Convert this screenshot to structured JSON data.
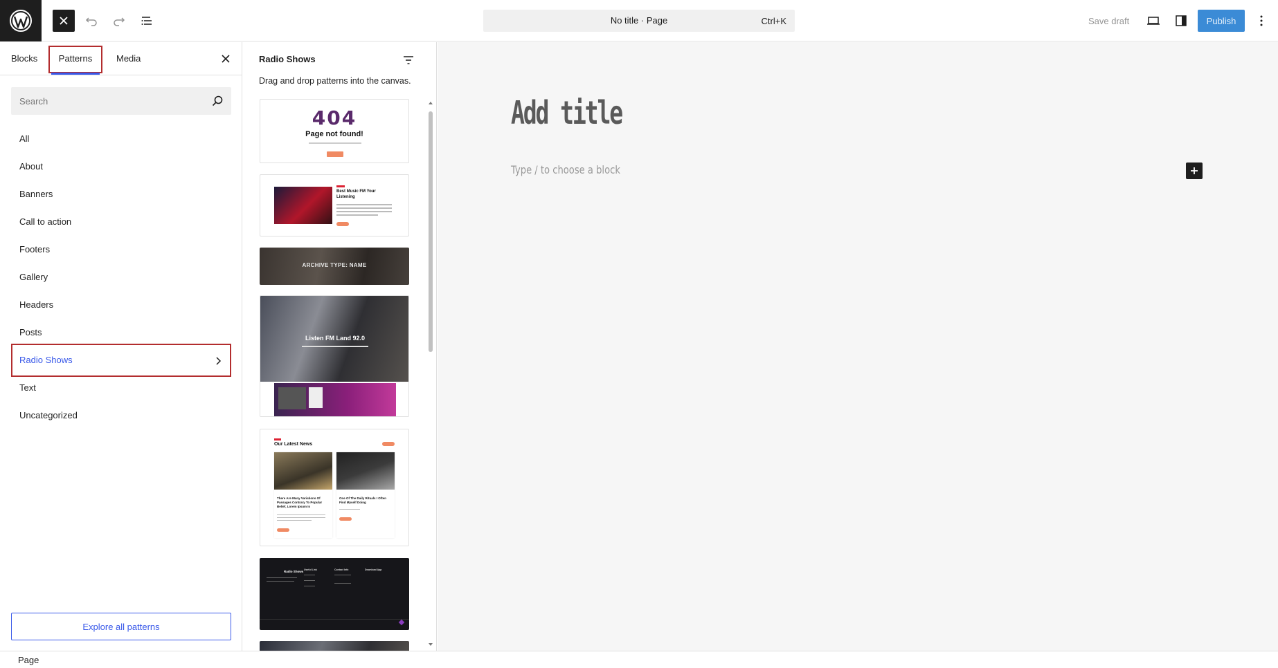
{
  "topbar": {
    "document_title": "No title · Page",
    "shortcut": "Ctrl+K",
    "save_draft_label": "Save draft",
    "publish_label": "Publish",
    "icons": [
      "wordpress-logo",
      "close-icon",
      "undo-icon",
      "redo-icon",
      "document-overview-icon",
      "view-icon",
      "settings-icon",
      "options-icon"
    ]
  },
  "inserter": {
    "tabs": [
      {
        "label": "Blocks",
        "active": false
      },
      {
        "label": "Patterns",
        "active": true
      },
      {
        "label": "Media",
        "active": false
      }
    ],
    "search_placeholder": "Search",
    "categories": [
      {
        "label": "All"
      },
      {
        "label": "About"
      },
      {
        "label": "Banners"
      },
      {
        "label": "Call to action"
      },
      {
        "label": "Footers"
      },
      {
        "label": "Gallery"
      },
      {
        "label": "Headers"
      },
      {
        "label": "Posts"
      },
      {
        "label": "Radio Shows",
        "active": true
      },
      {
        "label": "Text"
      },
      {
        "label": "Uncategorized"
      }
    ],
    "explore_label": "Explore all patterns"
  },
  "patterns_panel": {
    "title": "Radio Shows",
    "description": "Drag and drop patterns into the canvas.",
    "previews": {
      "p404_number": "404",
      "p404_message": "Page not found!",
      "music_heading": "Best Music FM Your Listening",
      "archive_text": "ARCHIVE TYPE: NAME",
      "hero_title": "Listen FM Land 92.0",
      "news_title": "Our Latest News",
      "news_card_1": "There Are Many Variations Of Passages Contrary To Popular Belief, Lorem Ipsum Is",
      "news_card_2": "One Of The Daily Rituals I Often Find Myself Doing",
      "footer_brand": "Radio Shows",
      "footer_col_1": "Useful Link",
      "footer_col_2": "Contact Info",
      "footer_col_3": "Download App"
    }
  },
  "canvas": {
    "title_placeholder": "Add title",
    "block_hint": "Type / to choose a block"
  },
  "footer": {
    "breadcrumb": "Page"
  },
  "colors": {
    "accent": "#3858e9",
    "highlight_border": "#b32d2e",
    "publish": "#3b8bd6"
  }
}
